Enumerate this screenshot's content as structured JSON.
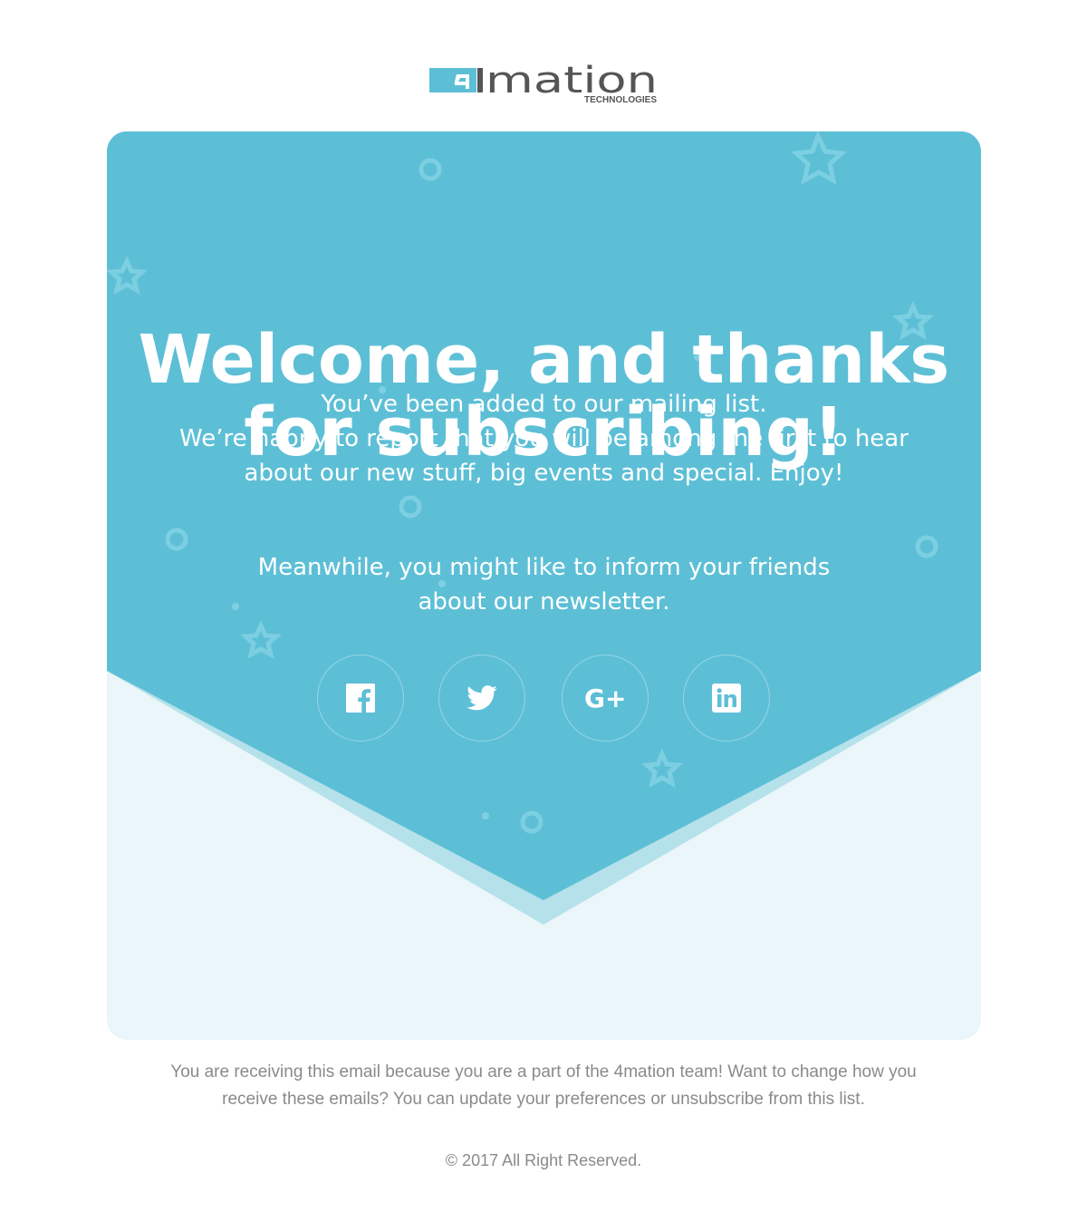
{
  "logo": {
    "text": "4mation",
    "subtext": "TECHNOLOGIES"
  },
  "hero": {
    "title_line1": "Welcome, and thanks",
    "title_line2": "for subscribing!",
    "intro_lines": [
      "You’ve been added to our mailing list.",
      "We’re happy to report that you will be among the first to hear",
      "about our new stuff, big events and special. Enjoy!"
    ],
    "share_lines": [
      "Meanwhile, you might like to inform your friends",
      "about our newsletter."
    ]
  },
  "social": [
    {
      "name": "facebook",
      "icon": "facebook-icon"
    },
    {
      "name": "twitter",
      "icon": "twitter-icon"
    },
    {
      "name": "google-plus",
      "icon": "google-plus-icon"
    },
    {
      "name": "linkedin",
      "icon": "linkedin-icon"
    }
  ],
  "footer": {
    "line1": "You are receiving this email because you are a part of the 4mation team! Want to change how you",
    "line2": "receive these emails? You can update your preferences or unsubscribe from this list.",
    "copyright": "© 2017 All Right Reserved."
  },
  "colors": {
    "brand": "#5dbfd6",
    "light": "#eaf6f9",
    "band": "#b5e1ea",
    "logo_gray": "#555555"
  }
}
